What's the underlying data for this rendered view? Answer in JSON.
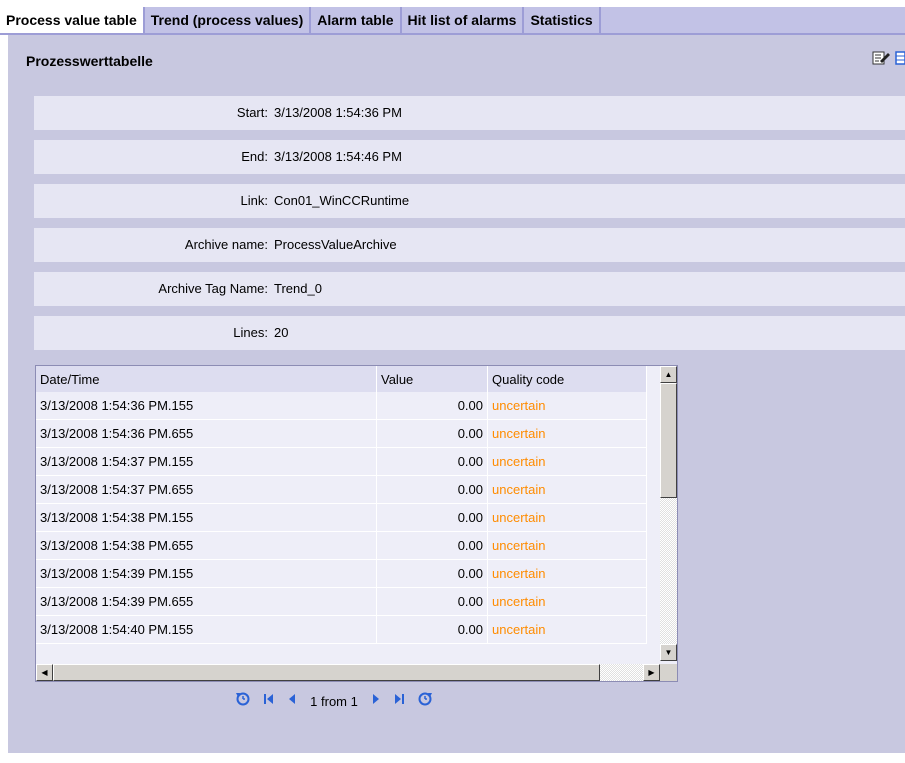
{
  "tabs": [
    {
      "label": "Process value table"
    },
    {
      "label": "Trend (process values)"
    },
    {
      "label": "Alarm table"
    },
    {
      "label": "Hit list of alarms"
    },
    {
      "label": "Statistics"
    }
  ],
  "panel": {
    "title": "Prozesswerttabelle",
    "tools": [
      "edit-icon",
      "layout-icon"
    ]
  },
  "info": [
    {
      "label": "Start:",
      "value": "3/13/2008 1:54:36 PM"
    },
    {
      "label": "End:",
      "value": "3/13/2008 1:54:46 PM"
    },
    {
      "label": "Link:",
      "value": "Con01_WinCCRuntime"
    },
    {
      "label": "Archive name:",
      "value": "ProcessValueArchive"
    },
    {
      "label": "Archive Tag Name:",
      "value": "Trend_0"
    },
    {
      "label": "Lines:",
      "value": "20"
    }
  ],
  "table": {
    "columns": [
      "Date/Time",
      "Value",
      "Quality code"
    ],
    "rows": [
      {
        "dt": "3/13/2008 1:54:36 PM.155",
        "value": "0.00",
        "quality": "uncertain"
      },
      {
        "dt": "3/13/2008 1:54:36 PM.655",
        "value": "0.00",
        "quality": "uncertain"
      },
      {
        "dt": "3/13/2008 1:54:37 PM.155",
        "value": "0.00",
        "quality": "uncertain"
      },
      {
        "dt": "3/13/2008 1:54:37 PM.655",
        "value": "0.00",
        "quality": "uncertain"
      },
      {
        "dt": "3/13/2008 1:54:38 PM.155",
        "value": "0.00",
        "quality": "uncertain"
      },
      {
        "dt": "3/13/2008 1:54:38 PM.655",
        "value": "0.00",
        "quality": "uncertain"
      },
      {
        "dt": "3/13/2008 1:54:39 PM.155",
        "value": "0.00",
        "quality": "uncertain"
      },
      {
        "dt": "3/13/2008 1:54:39 PM.655",
        "value": "0.00",
        "quality": "uncertain"
      },
      {
        "dt": "3/13/2008 1:54:40 PM.155",
        "value": "0.00",
        "quality": "uncertain"
      }
    ]
  },
  "pager": {
    "text": "1 from 1"
  },
  "colors": {
    "accent": "#9d9dd6",
    "panel": "#c8c8e0",
    "quality_uncertain": "#ff8c00",
    "pager_icons": "#2a62d6"
  }
}
